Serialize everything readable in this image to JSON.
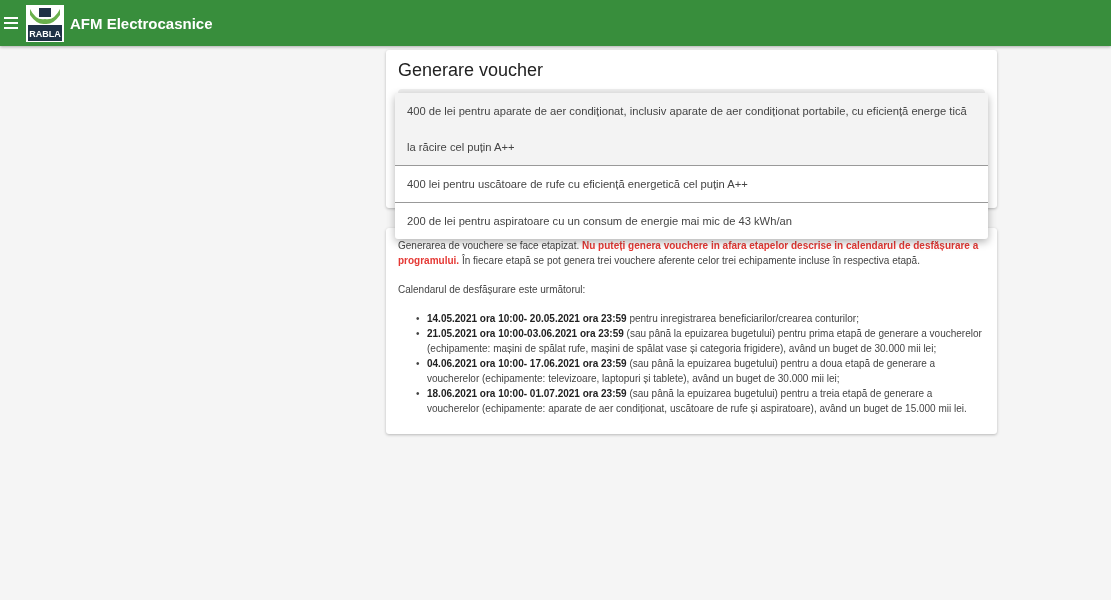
{
  "app_bar": {
    "title": "AFM Electrocasnice",
    "logo_text": "RABLA"
  },
  "voucher_card": {
    "title": "Generare voucher",
    "dropdown_options": [
      {
        "label": "400 de lei pentru aparate de aer condiționat, inclusiv aparate de aer condiționat portabile, cu eficiență energe tică la răcire cel puțin A++",
        "highlighted": true
      },
      {
        "label": "400 lei pentru uscătoare de rufe cu eficiență energetică cel puțin A++",
        "highlighted": false
      },
      {
        "label": "200 de lei pentru aspiratoare cu un consum de energie mai mic de 43 kWh/an",
        "highlighted": false
      }
    ]
  },
  "info_card": {
    "intro": "Generarea de vouchere se face etapizat.",
    "warning": "Nu puteți genera vouchere in afara etapelor descrise in calendarul de desfășurare a programului.",
    "intro_rest": "În fiecare etapă se pot genera trei vouchere aferente celor trei echipamente incluse în respectiva etapă.",
    "calendar_heading": "Calendarul de desfășurare este următorul:",
    "schedule": [
      {
        "bullet": "•",
        "text": "**14.05.2021 ora 10:00- 20.05.2021 ora 23:59** pentru inregistrarea beneficiarilor/crearea conturilor;"
      },
      {
        "bullet": "•",
        "text": "**21.05.2021 ora 10:00-03.06.2021 ora 23:59** (sau până la epuizarea bugetului) pentru prima etapă de generare a voucherelor (echipamente: mașini de spălat rufe, mașini de spălat vase și categoria frigidere), având un buget de 30.000 mii lei;"
      },
      {
        "bullet": "•",
        "text": "**04.06.2021 ora 10:00- 17.06.2021 ora 23:59** (sau până la epuizarea bugetului) pentru a doua etapă de generare a voucherelor (echipamente: televizoare, laptopuri și tablete), având un buget de 30.000 mii lei;"
      },
      {
        "bullet": "•",
        "text": "**18.06.2021 ora 10:00- 01.07.2021 ora 23:59** (sau până la epuizarea bugetului) pentru a treia etapă de generare a voucherelor (echipamente: aparate de aer condiționat, uscătoare de rufe și aspiratoare), având un buget de 15.000 mii lei."
      }
    ]
  }
}
